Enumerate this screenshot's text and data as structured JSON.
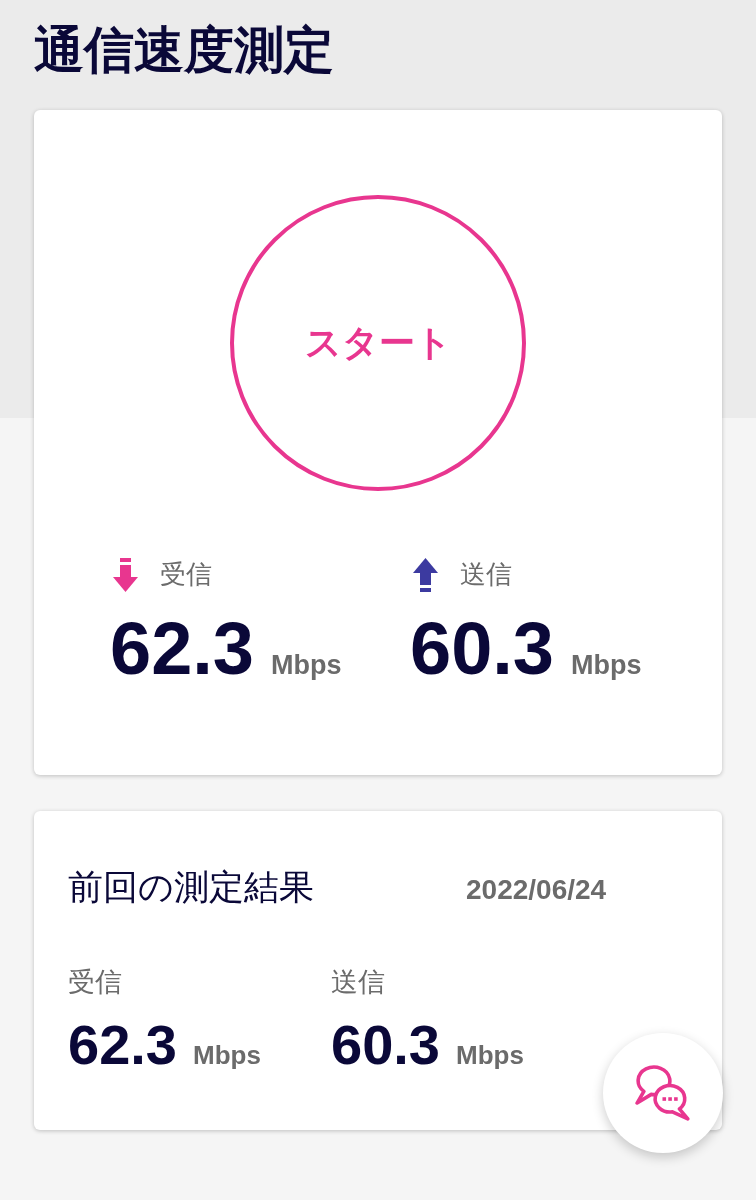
{
  "header": {
    "title": "通信速度測定"
  },
  "speed_test": {
    "start_button": "スタート",
    "metrics": [
      {
        "kind": "download",
        "label": "受信",
        "value": "62.3",
        "unit": "Mbps"
      },
      {
        "kind": "upload",
        "label": "送信",
        "value": "60.3",
        "unit": "Mbps"
      }
    ]
  },
  "last_result": {
    "title": "前回の測定結果",
    "date": "2022/06/24",
    "metrics": [
      {
        "label": "受信",
        "value": "62.3",
        "unit": "Mbps"
      },
      {
        "label": "送信",
        "value": "60.3",
        "unit": "Mbps"
      }
    ]
  }
}
